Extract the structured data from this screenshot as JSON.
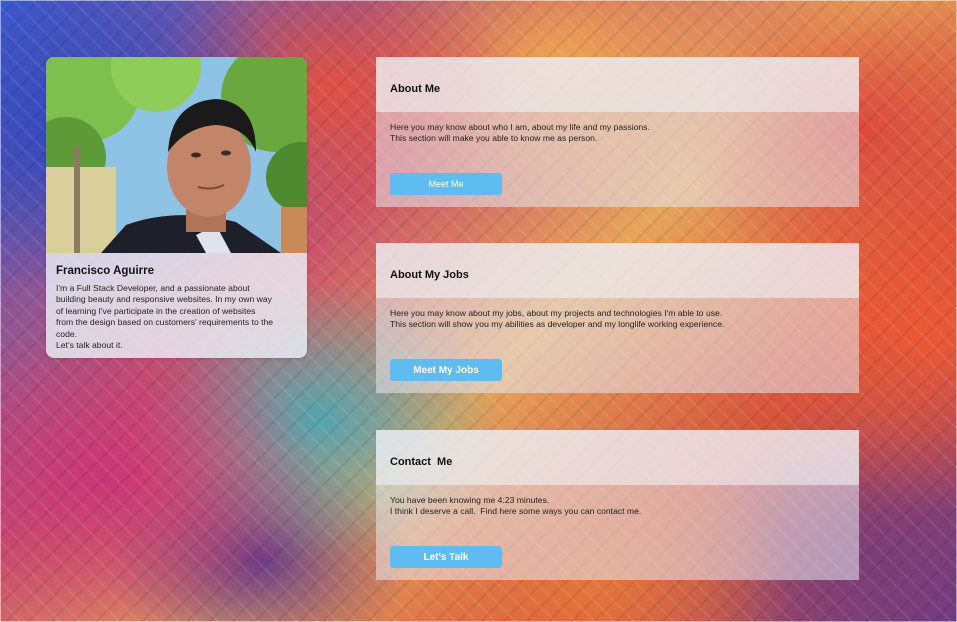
{
  "profile": {
    "name": "Francisco Aguirre",
    "bio_lines": [
      "I'm a Full Stack Developer, and a passionate about",
      "building beauty and responsive websites. In my own way",
      "of learning I've participate in the creation of websites",
      "from the design based on customers' requirements to the",
      "code.",
      "Let's talk about it."
    ]
  },
  "sections": [
    {
      "title": "About Me",
      "body_lines": [
        "Here you may know about who I am, about my life and my passions.",
        "This section will make you able to know me as person."
      ],
      "button_label": "Meet Me"
    },
    {
      "title": "About My Jobs",
      "body_lines": [
        "Here you may know about my jobs, about my projects and technologies I'm able to use.",
        "This section will show you my abilities as developer and my longlife working experience."
      ],
      "button_label": "Meet My Jobs"
    },
    {
      "title": "Contact  Me",
      "body_lines": [
        "You have been knowing me 4:23 minutes.",
        "I think I deserve a call.  Find here some ways you can contact me."
      ],
      "button_label": "Let's Talk"
    }
  ],
  "colors": {
    "button": "#5fbcf0",
    "panel": "#e6e8f0"
  }
}
